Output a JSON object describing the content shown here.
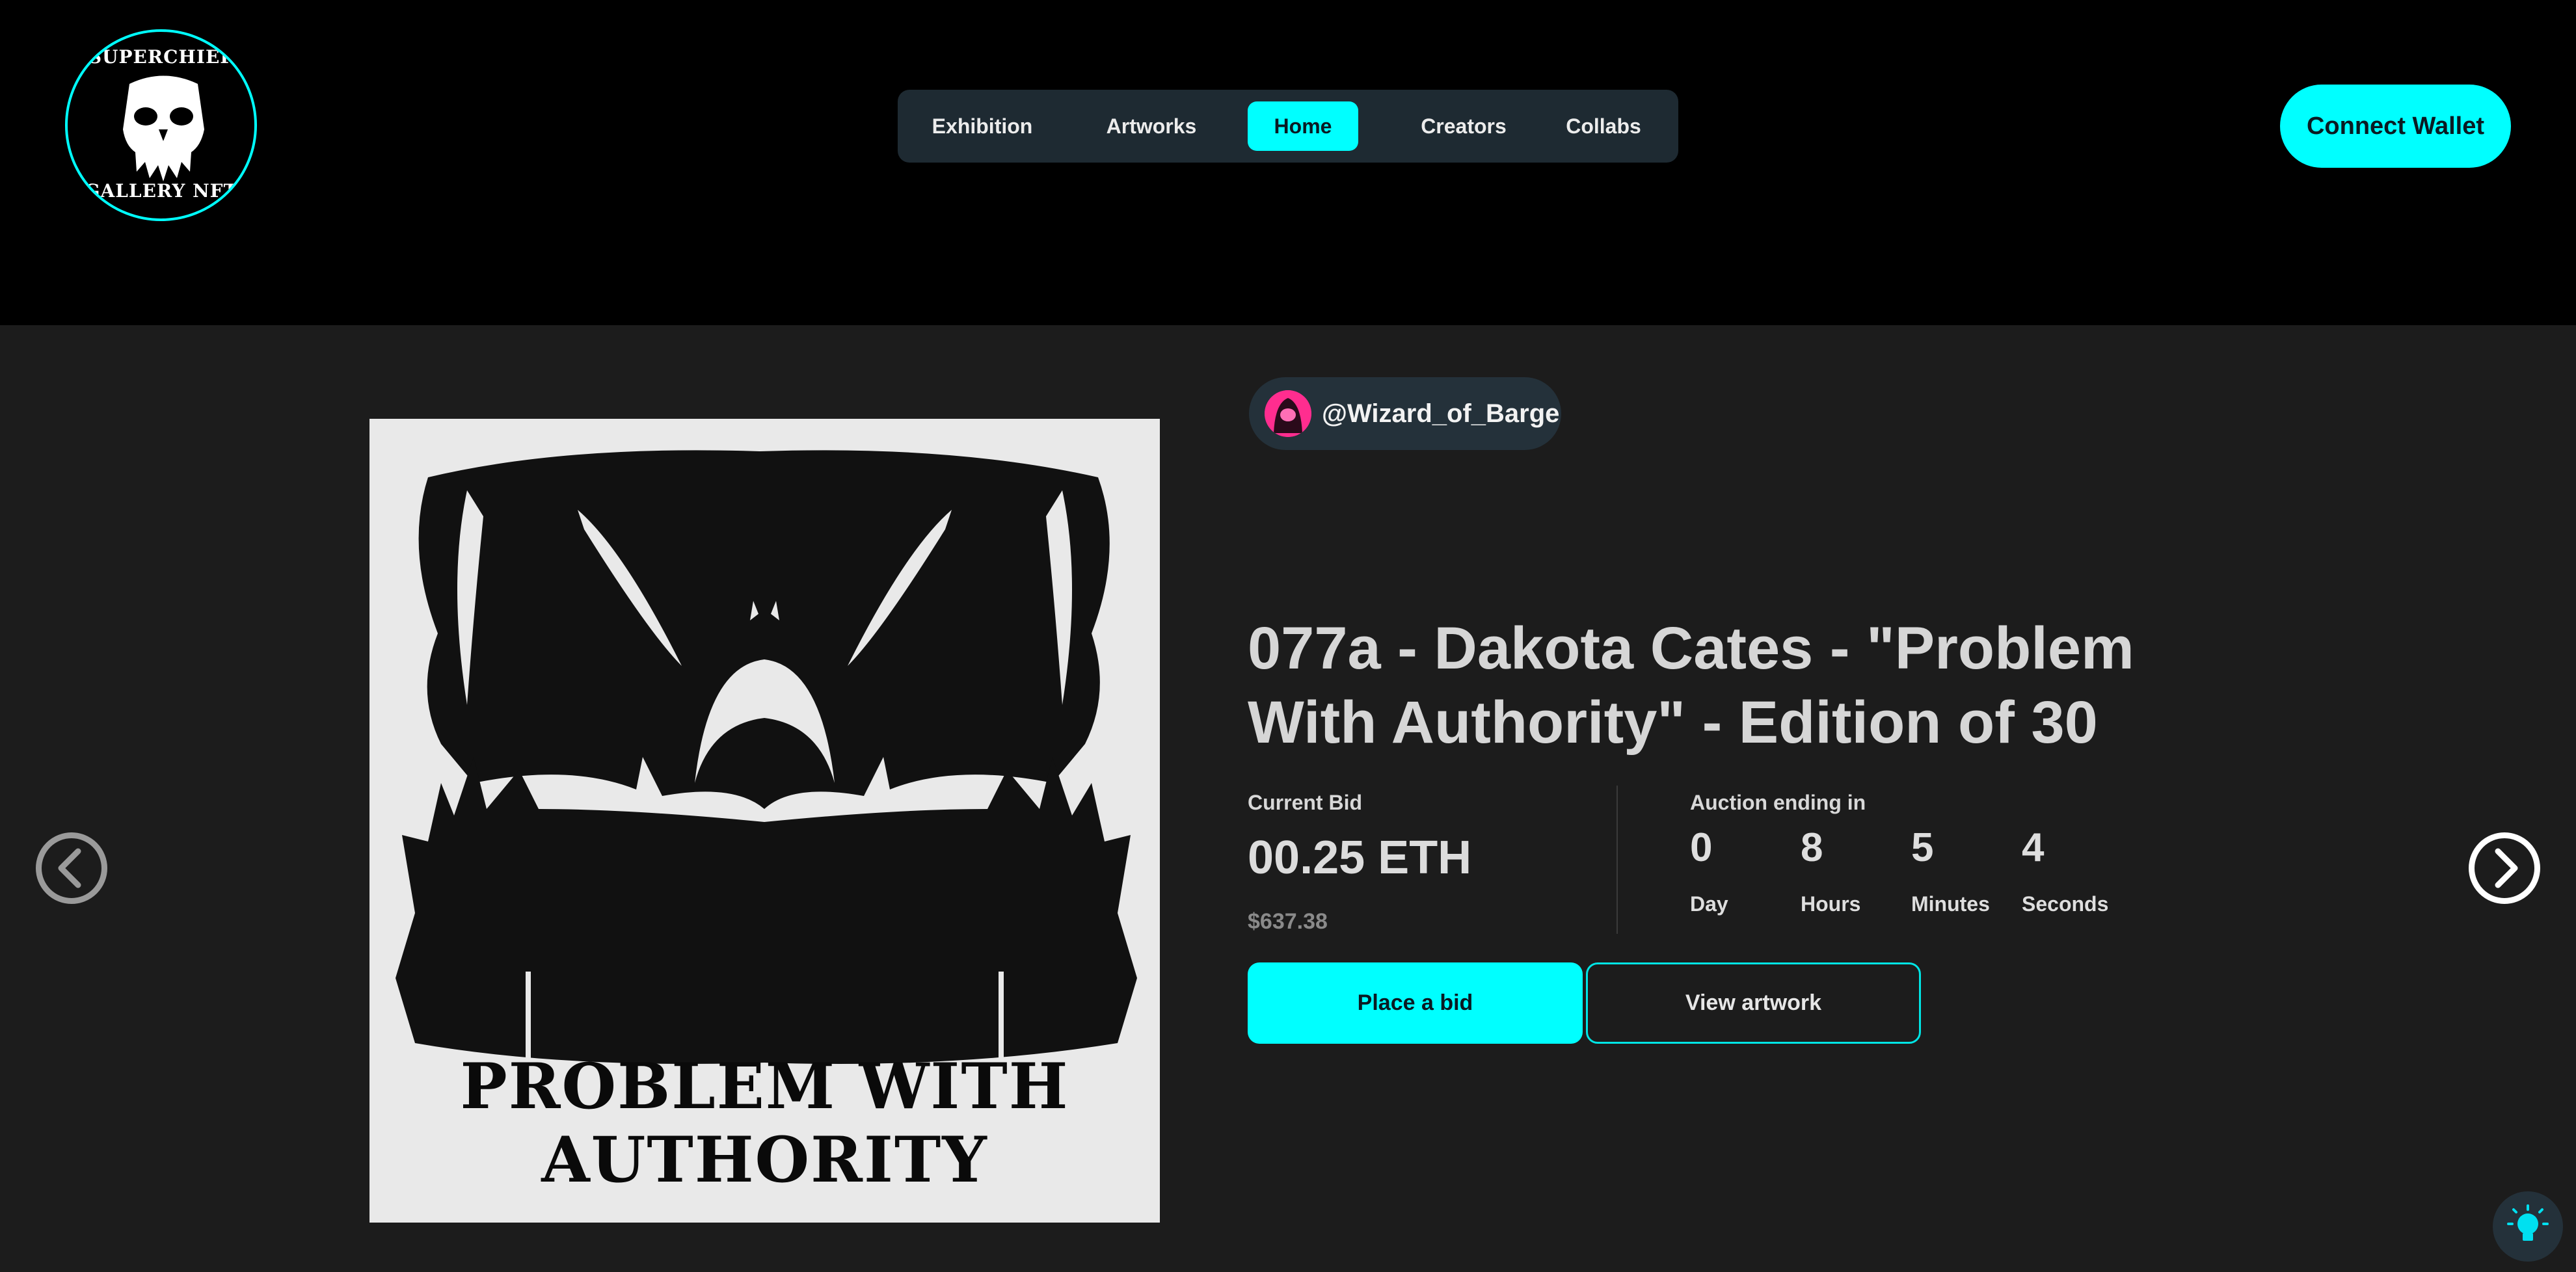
{
  "header": {
    "logo": {
      "top_text": "SUPERCHIEF",
      "bottom_text": "GALLERY NFT"
    },
    "nav": [
      {
        "label": "Exhibition",
        "active": false
      },
      {
        "label": "Artworks",
        "active": false
      },
      {
        "label": "Home",
        "active": true
      },
      {
        "label": "Creators",
        "active": false
      },
      {
        "label": "Collabs",
        "active": false
      }
    ],
    "connect_label": "Connect Wallet"
  },
  "artwork": {
    "caption": "PROBLEM WITH AUTHORITY",
    "creator_handle": "@Wizard_of_Barge",
    "title": "077a - Dakota Cates - \"Problem With Authority\" - Edition of 30"
  },
  "bid": {
    "label": "Current Bid",
    "value": "00.25 ETH",
    "usd": "$637.38"
  },
  "auction": {
    "label": "Auction ending in",
    "countdown": [
      {
        "value": "0",
        "unit": "Day"
      },
      {
        "value": "8",
        "unit": "Hours"
      },
      {
        "value": "5",
        "unit": "Minutes"
      },
      {
        "value": "4",
        "unit": "Seconds"
      }
    ]
  },
  "actions": {
    "place_bid": "Place a bid",
    "view_artwork": "View artwork"
  },
  "colors": {
    "accent": "#00ffff",
    "header_bg": "#000000",
    "page_bg": "#1c1c1c",
    "nav_bg": "#1e2a32"
  },
  "icons": {
    "prev": "chevron-left-icon",
    "next": "chevron-right-icon",
    "theme": "lightbulb-icon"
  }
}
